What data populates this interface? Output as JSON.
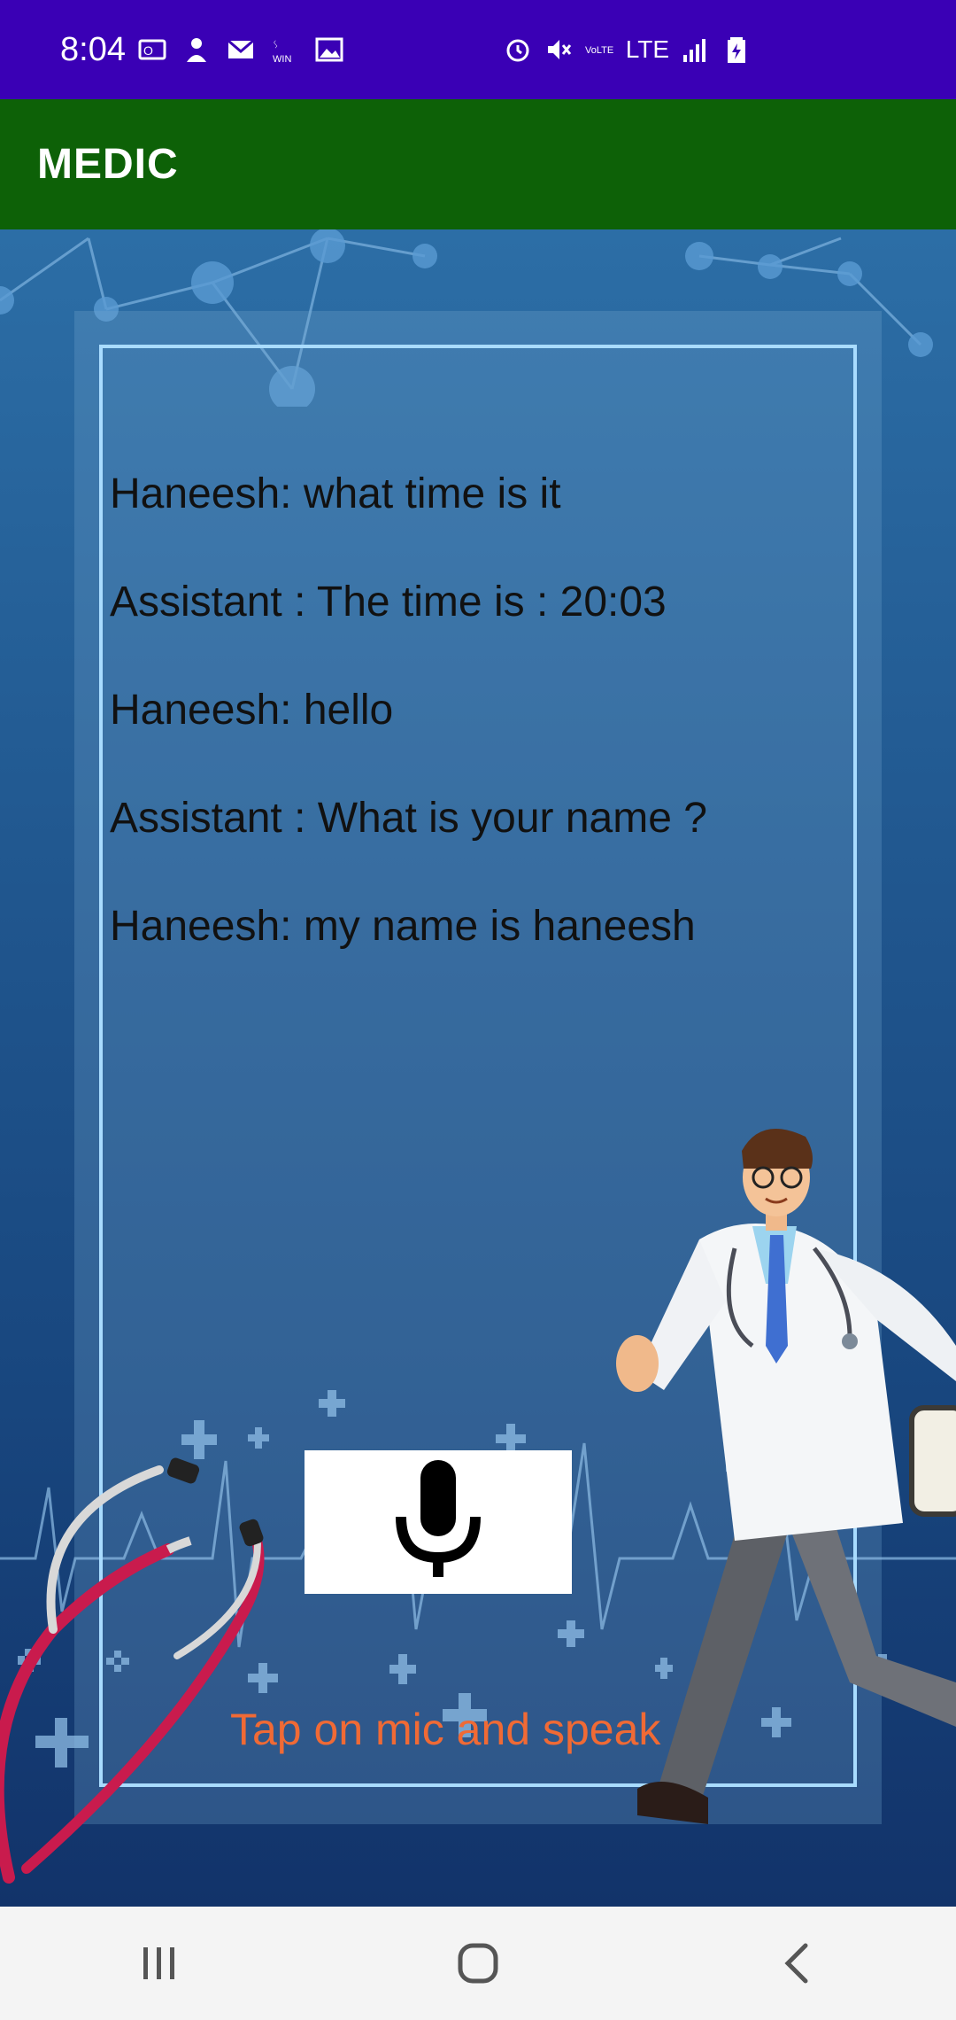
{
  "status_bar": {
    "time": "8:04",
    "left_icons": [
      "outlook-icon",
      "person-icon",
      "mail-icon",
      "win-icon",
      "image-icon"
    ],
    "right_icons": [
      "alarm-icon",
      "mute-icon",
      "volte-icon",
      "lte-icon",
      "signal-icon",
      "battery-icon"
    ],
    "lte_label": "LTE"
  },
  "app_bar": {
    "title": "MEDIC",
    "color": "#0d6107"
  },
  "conversation": [
    {
      "speaker": "Haneesh",
      "text": "Haneesh: what time is it"
    },
    {
      "speaker": "Assistant",
      "text": "Assistant : The time is : 20:03"
    },
    {
      "speaker": "Haneesh",
      "text": "Haneesh: hello"
    },
    {
      "speaker": "Assistant",
      "text": "Assistant : What is your name ?"
    },
    {
      "speaker": "Haneesh",
      "text": "Haneesh: my name is haneesh"
    }
  ],
  "mic": {
    "icon": "microphone-icon"
  },
  "hint": {
    "text": "Tap on mic and speak",
    "color": "#f06a35"
  },
  "nav": {
    "buttons": [
      "recent-apps-icon",
      "home-icon",
      "back-icon"
    ]
  }
}
